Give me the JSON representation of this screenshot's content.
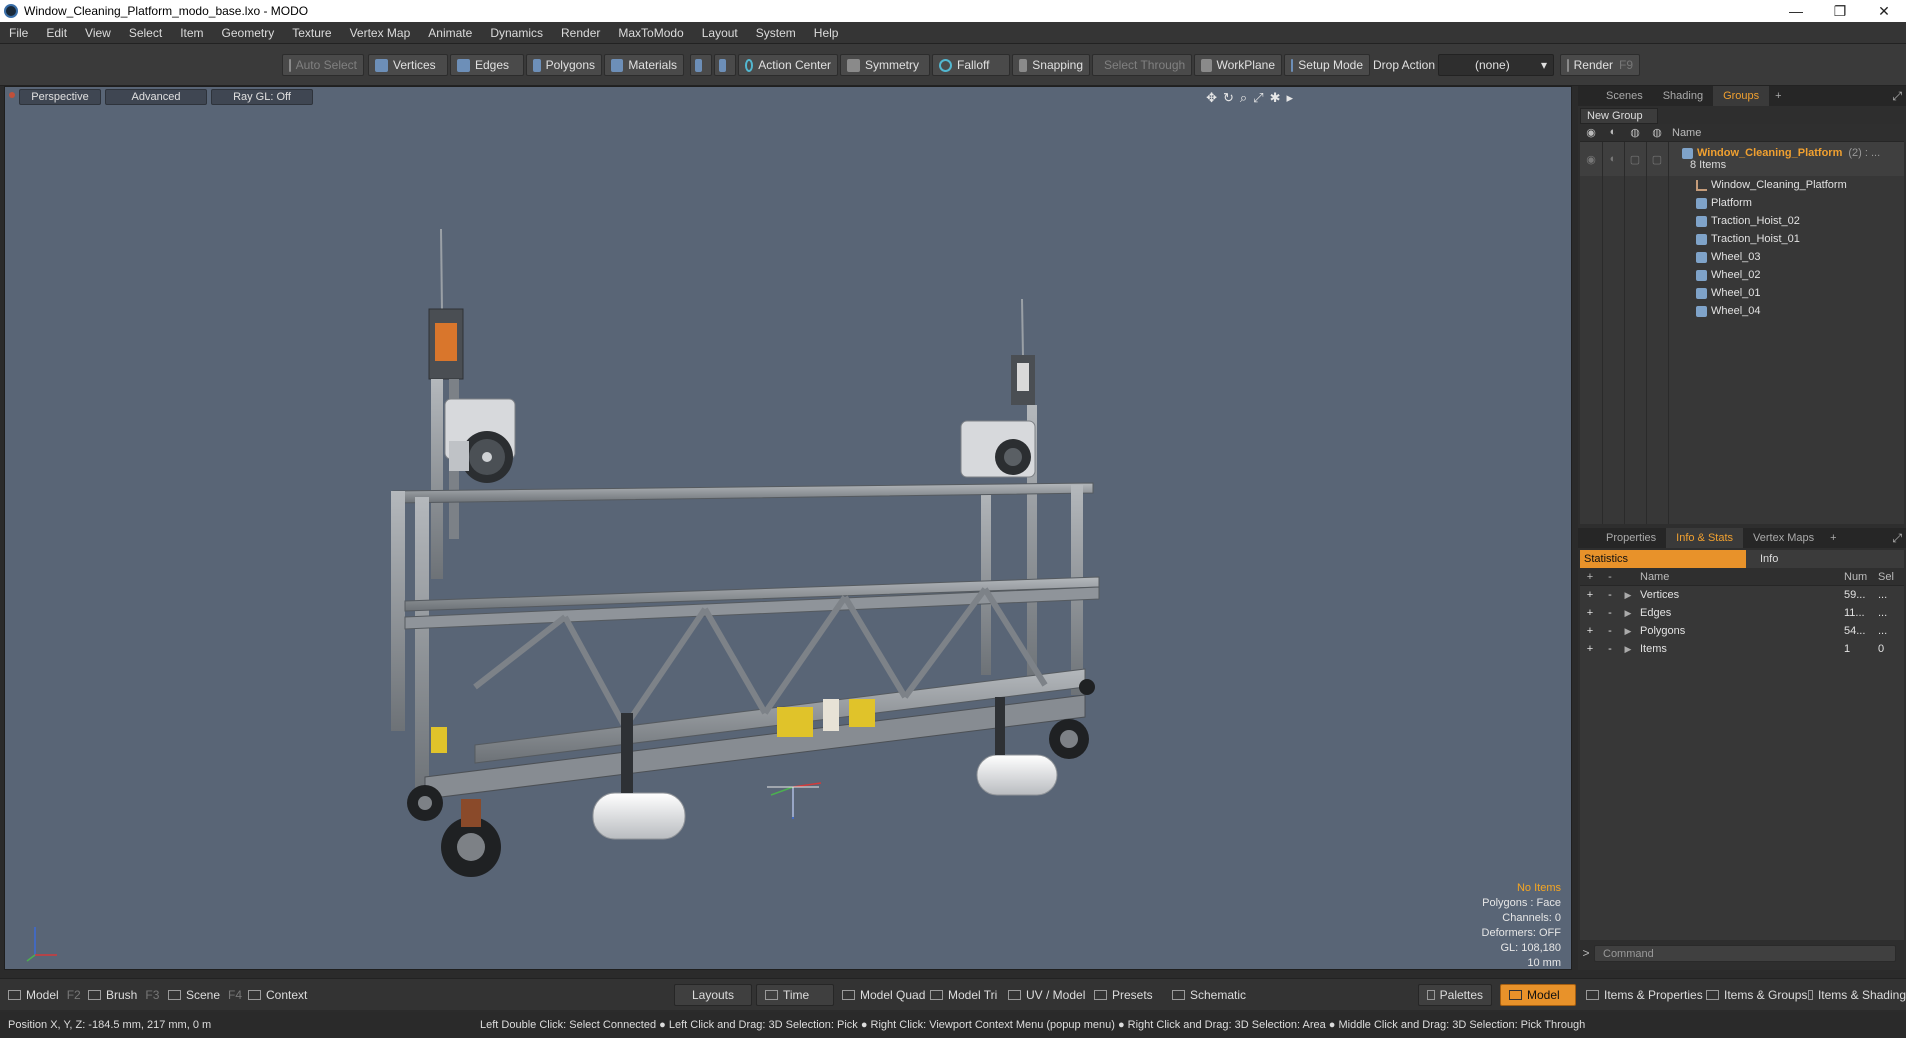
{
  "window": {
    "title": "Window_Cleaning_Platform_modo_base.lxo - MODO",
    "minimize": "—",
    "restore": "❐",
    "close": "✕"
  },
  "menu": [
    "File",
    "Edit",
    "View",
    "Select",
    "Item",
    "Geometry",
    "Texture",
    "Vertex Map",
    "Animate",
    "Dynamics",
    "Render",
    "MaxToModo",
    "Layout",
    "System",
    "Help"
  ],
  "toolbar": {
    "auto_select": "Auto Select",
    "vertices": "Vertices",
    "edges": "Edges",
    "polygons": "Polygons",
    "materials": "Materials",
    "action_center": "Action Center",
    "symmetry": "Symmetry",
    "falloff": "Falloff",
    "snapping": "Snapping",
    "select_through": "Select Through",
    "workplane": "WorkPlane",
    "setup_mode": "Setup Mode",
    "drop_action_label": "Drop Action",
    "drop_action_value": "(none)",
    "render": "Render",
    "render_key": "F9"
  },
  "viewport": {
    "view_mode": "Perspective",
    "shading": "Advanced",
    "ray_gl": "Ray GL: Off",
    "overlay": {
      "selection": "No Items",
      "polygons": "Polygons : Face",
      "channels": "Channels: 0",
      "deformers": "Deformers: OFF",
      "gl": "GL: 108,180",
      "scale": "10 mm"
    }
  },
  "groups_panel": {
    "tabs": [
      "Scenes",
      "Shading",
      "Groups"
    ],
    "active_tab": "Groups",
    "new_group": "New Group",
    "column_name": "Name",
    "group_name": "Window_Cleaning_Platform",
    "group_count": "(2) : ...",
    "group_items": "8 Items",
    "items": [
      "Window_Cleaning_Platform",
      "Platform",
      "Traction_Hoist_02",
      "Traction_Hoist_01",
      "Wheel_03",
      "Wheel_02",
      "Wheel_01",
      "Wheel_04"
    ]
  },
  "stats_panel": {
    "tabs": [
      "Properties",
      "Info & Stats",
      "Vertex Maps"
    ],
    "active_tab": "Info & Stats",
    "sub_tabs": [
      "Statistics",
      "Info"
    ],
    "headers": {
      "name": "Name",
      "num": "Num",
      "sel": "Sel"
    },
    "rows": [
      {
        "name": "Vertices",
        "num": "59...",
        "sel": "..."
      },
      {
        "name": "Edges",
        "num": "11...",
        "sel": "..."
      },
      {
        "name": "Polygons",
        "num": "54...",
        "sel": "..."
      },
      {
        "name": "Items",
        "num": "1",
        "sel": "0"
      }
    ],
    "command_placeholder": "Command"
  },
  "bottom_bar": {
    "model": "Model",
    "model_key": "F2",
    "brush": "Brush",
    "brush_key": "F3",
    "scene": "Scene",
    "scene_key": "F4",
    "context": "Context",
    "layouts": "Layouts",
    "time": "Time",
    "model_quad": "Model Quad",
    "model_tri": "Model Tri",
    "uv_model": "UV / Model",
    "presets": "Presets",
    "schematic": "Schematic",
    "palettes": "Palettes",
    "model_active": "Model",
    "items_properties": "Items & Properties",
    "items_groups": "Items & Groups",
    "items_shading": "Items & Shading"
  },
  "status": {
    "position": "Position X, Y, Z:   -184.5 mm, 217 mm, 0 m",
    "hint": "Left Double Click: Select Connected ● Left Click and Drag: 3D Selection: Pick ● Right Click: Viewport Context Menu (popup menu) ● Right Click and Drag: 3D Selection: Area ● Middle Click and Drag: 3D Selection: Pick Through"
  },
  "colors": {
    "accent": "#e8922a",
    "viewport_bg": "#596576",
    "group_name": "#f0a030"
  }
}
